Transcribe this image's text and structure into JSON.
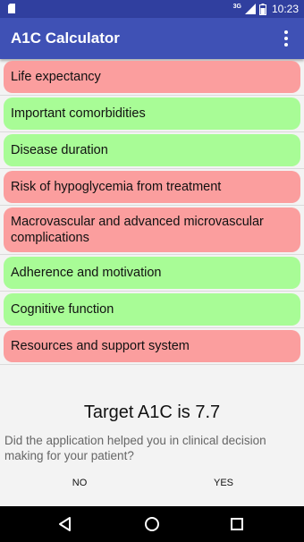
{
  "status_bar": {
    "network": "3G",
    "time": "10:23"
  },
  "app_bar": {
    "title": "A1C Calculator",
    "menu_icon": "overflow-menu-icon"
  },
  "factors": [
    {
      "label": "Life expectancy",
      "color": "red"
    },
    {
      "label": "Important comorbidities",
      "color": "green"
    },
    {
      "label": "Disease duration",
      "color": "green"
    },
    {
      "label": "Risk of hypoglycemia from treatment",
      "color": "red"
    },
    {
      "label": "Macrovascular and advanced microvascular complications",
      "color": "red"
    },
    {
      "label": "Adherence and motivation",
      "color": "green"
    },
    {
      "label": "Cognitive function",
      "color": "green"
    },
    {
      "label": "Resources and support system",
      "color": "red"
    }
  ],
  "colors": {
    "red": "#fb9e9e",
    "green": "#a8fc96",
    "app_bar": "#3f51b5",
    "status_bar": "#303f9f"
  },
  "result": {
    "text": "Target A1C is 7.7"
  },
  "feedback": {
    "question": "Did the application helped you in clinical decision making for your patient?",
    "no_label": "NO",
    "yes_label": "YES"
  },
  "nav": {
    "back_icon": "back-icon",
    "home_icon": "home-icon",
    "recents_icon": "recents-icon"
  }
}
